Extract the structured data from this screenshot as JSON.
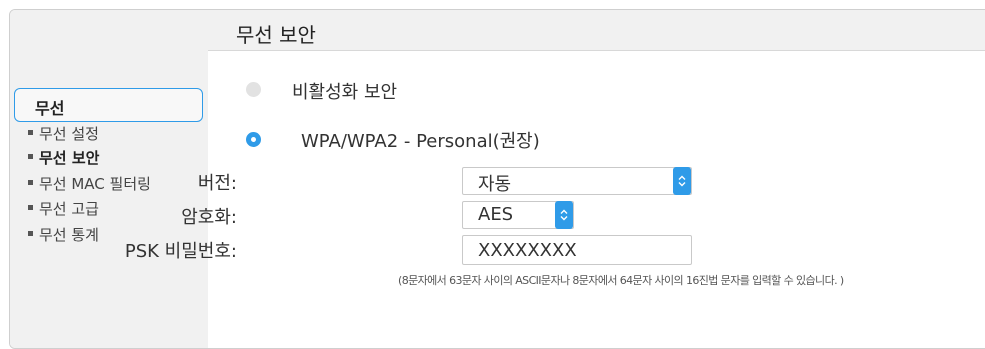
{
  "header": {
    "title": "무선 보안"
  },
  "sidebar": {
    "group_label": "무선",
    "items": [
      {
        "label": "무선 설정"
      },
      {
        "label": "무선 보안"
      },
      {
        "label": "무선 MAC 필터링"
      },
      {
        "label": "무선 고급"
      },
      {
        "label": "무선 통계"
      }
    ],
    "active_index": 1
  },
  "security": {
    "option_disabled": "비활성화 보안",
    "option_wpa": "WPA/WPA2 - Personal(권장)",
    "selected": "WPA/WPA2 - Personal(권장)",
    "version_label": "버전:",
    "version_value": "자동",
    "encryption_label": "암호화:",
    "encryption_value": "AES",
    "psk_label": "PSK 비밀번호:",
    "psk_value": "XXXXXXXX",
    "psk_hint": "(8문자에서 63문자 사이의 ASCII문자나 8문자에서 64문자 사이의 16진법 문자를 입력할 수 있습니다. )"
  },
  "colors": {
    "accent": "#2f9be8",
    "panel_bg": "#f1f1f1",
    "border": "#cfcfcf"
  },
  "icons": {
    "select_arrow": "updown-chevron-icon"
  }
}
